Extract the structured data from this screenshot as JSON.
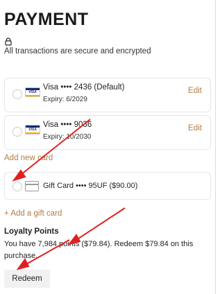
{
  "page": {
    "title": "PAYMENT",
    "secure_text": "All transactions are secure and encrypted"
  },
  "cards": [
    {
      "brand": "VISA",
      "name": "Visa •••• 2436 (Default)",
      "expiry": "Expiry: 6/2029",
      "edit_label": "Edit"
    },
    {
      "brand": "VISA",
      "name": "Visa •••• 9036",
      "expiry": "Expiry: 10/2030",
      "edit_label": "Edit"
    }
  ],
  "add_card_label": "Add new card",
  "gift_card": {
    "name": "Gift Card •••• 95UF ($90.00)"
  },
  "add_gift_label": "+ Add a gift card",
  "loyalty": {
    "title": "Loyalty Points",
    "text": "You have 7,984 points ($79.84). Redeem $79.84 on this purchase.",
    "redeem_label": "Redeem"
  },
  "colors": {
    "accent": "#b07d45",
    "annotation_arrow": "#e02020"
  }
}
